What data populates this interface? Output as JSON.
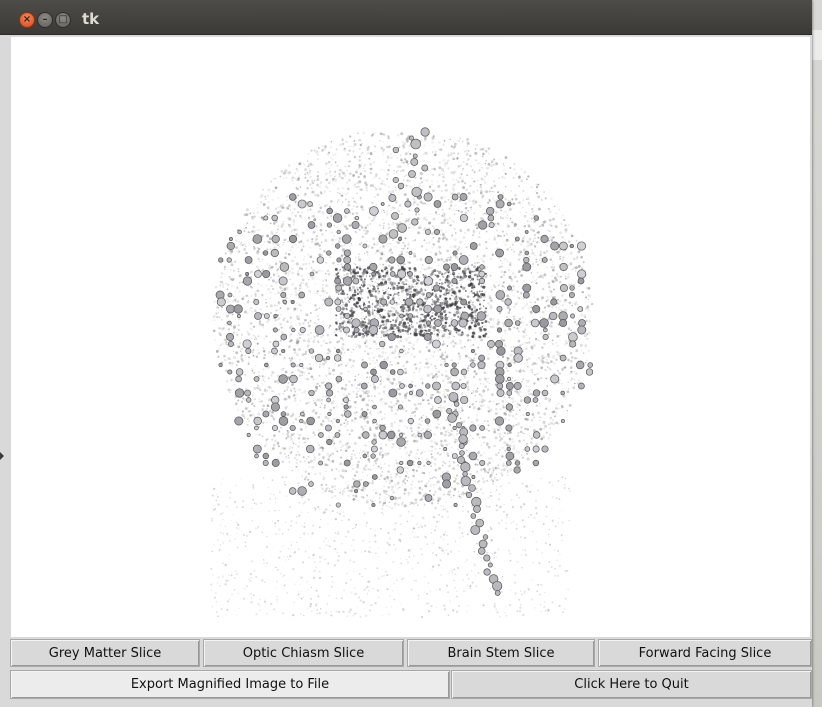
{
  "window": {
    "title": "tk",
    "controls": {
      "close": "×",
      "minimize": "–",
      "maximize": "□"
    }
  },
  "canvas": {
    "image": "brain-scatter-rendering"
  },
  "buttons_row1": [
    {
      "label": "Grey Matter Slice"
    },
    {
      "label": "Optic Chiasm Slice"
    },
    {
      "label": "Brain Stem Slice"
    },
    {
      "label": "Forward Facing Slice"
    }
  ],
  "buttons_row2": [
    {
      "label": "Export Magnified Image to File"
    },
    {
      "label": "Click Here to Quit"
    }
  ],
  "colors": {
    "titlebar": "#3b3a37",
    "close_button": "#e05a2a",
    "canvas_bg": "#ffffff",
    "button_bg": "#d9d9d9"
  }
}
